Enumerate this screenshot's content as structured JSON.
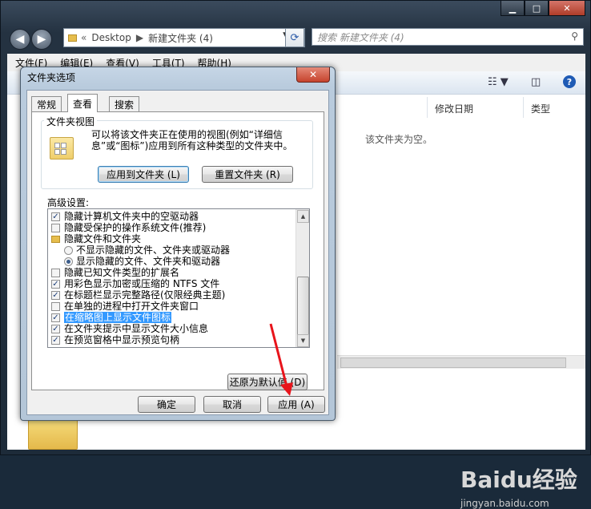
{
  "explorer": {
    "breadcrumb": [
      "Desktop",
      "新建文件夹 (4)"
    ],
    "search_placeholder": "搜索 新建文件夹 (4)",
    "menu": [
      "文件(F)",
      "编辑(E)",
      "查看(V)",
      "工具(T)",
      "帮助(H)"
    ],
    "columns": [
      "修改日期",
      "类型"
    ],
    "empty_message": "该文件夹为空。"
  },
  "dialog": {
    "title": "文件夹选项",
    "tabs": [
      "常规",
      "查看",
      "搜索"
    ],
    "active_tab": "查看",
    "folder_view": {
      "group_title": "文件夹视图",
      "description": "可以将该文件夹正在使用的视图(例如“详细信息”或“图标”)应用到所有这种类型的文件夹中。",
      "apply_button": "应用到文件夹 (L)",
      "reset_button": "重置文件夹 (R)"
    },
    "advanced_label": "高级设置:",
    "settings": [
      {
        "type": "checkbox",
        "checked": true,
        "label": "隐藏计算机文件夹中的空驱动器"
      },
      {
        "type": "checkbox",
        "checked": false,
        "label": "隐藏受保护的操作系统文件(推荐)"
      },
      {
        "type": "folder",
        "label": "隐藏文件和文件夹"
      },
      {
        "type": "radio",
        "checked": false,
        "label": "不显示隐藏的文件、文件夹或驱动器"
      },
      {
        "type": "radio",
        "checked": true,
        "label": "显示隐藏的文件、文件夹和驱动器"
      },
      {
        "type": "checkbox",
        "checked": false,
        "label": "隐藏已知文件类型的扩展名"
      },
      {
        "type": "checkbox",
        "checked": true,
        "label": "用彩色显示加密或压缩的 NTFS 文件"
      },
      {
        "type": "checkbox",
        "checked": true,
        "label": "在标题栏显示完整路径(仅限经典主题)"
      },
      {
        "type": "checkbox",
        "checked": false,
        "label": "在单独的进程中打开文件夹窗口"
      },
      {
        "type": "checkbox",
        "checked": true,
        "label": "在缩略图上显示文件图标",
        "selected": true
      },
      {
        "type": "checkbox",
        "checked": true,
        "label": "在文件夹提示中显示文件大小信息"
      },
      {
        "type": "checkbox",
        "checked": true,
        "label": "在预览窗格中显示预览句柄"
      }
    ],
    "restore_button": "还原为默认值 (D)",
    "ok_button": "确定",
    "cancel_button": "取消",
    "apply_button": "应用 (A)"
  },
  "watermark": {
    "logo": "Baidu经验",
    "url": "jingyan.baidu.com"
  },
  "colors": {
    "selection": "#3399ff",
    "annotation_arrow": "#e8141b"
  }
}
